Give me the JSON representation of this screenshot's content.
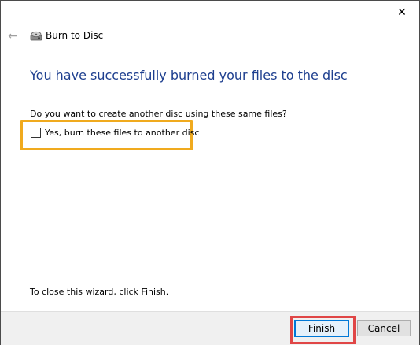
{
  "window": {
    "title": "Burn to Disc",
    "close_glyph": "✕",
    "back_glyph": "←"
  },
  "content": {
    "headline": "You have successfully burned your files to the disc",
    "question": "Do you want to create another disc using these same files?",
    "checkbox": {
      "label": "Yes, burn these files to another disc",
      "checked": false
    },
    "close_hint": "To close this wizard, click Finish."
  },
  "buttons": {
    "finish": "Finish",
    "cancel": "Cancel"
  },
  "colors": {
    "headline": "#1e3f8f",
    "checkbox_highlight": "#f0aa1e",
    "finish_highlight": "#e04646",
    "default_button_border": "#0078d7"
  }
}
